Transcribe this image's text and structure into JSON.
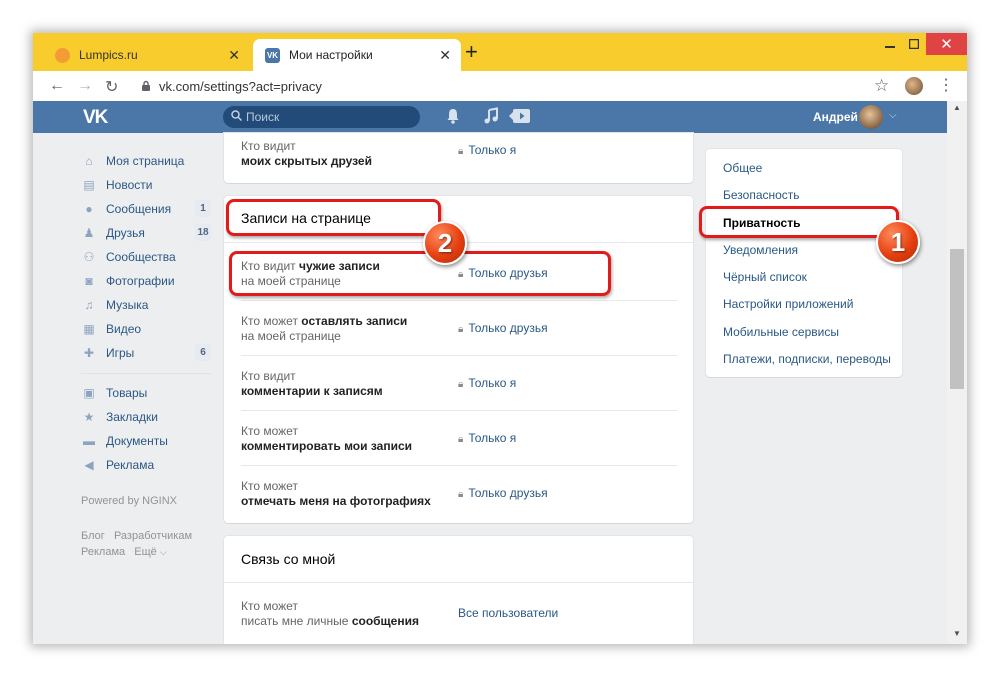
{
  "browser": {
    "tabs": [
      {
        "label": "Lumpics.ru",
        "favicon": "lumpics-icon",
        "active": false
      },
      {
        "label": "Мои настройки",
        "favicon": "vk-icon",
        "active": true
      }
    ],
    "new_tab": "+",
    "url": "vk.com/settings?act=privacy"
  },
  "header": {
    "logo": "VK",
    "search_placeholder": "Поиск",
    "user_name": "Андрей"
  },
  "sidebar": {
    "items": [
      {
        "label": "Моя страница",
        "icon": "home-icon"
      },
      {
        "label": "Новости",
        "icon": "news-icon"
      },
      {
        "label": "Сообщения",
        "icon": "messages-icon",
        "count": "1"
      },
      {
        "label": "Друзья",
        "icon": "friends-icon",
        "count": "18"
      },
      {
        "label": "Сообщества",
        "icon": "communities-icon"
      },
      {
        "label": "Фотографии",
        "icon": "photos-icon"
      },
      {
        "label": "Музыка",
        "icon": "music-icon"
      },
      {
        "label": "Видео",
        "icon": "video-icon"
      },
      {
        "label": "Игры",
        "icon": "games-icon",
        "count": "6"
      },
      {
        "label": "Товары",
        "icon": "goods-icon"
      },
      {
        "label": "Закладки",
        "icon": "bookmarks-icon"
      },
      {
        "label": "Документы",
        "icon": "documents-icon"
      },
      {
        "label": "Реклама",
        "icon": "ads-icon"
      }
    ],
    "powered": "Powered by NGINX",
    "footer_links": [
      "Блог",
      "Разработчикам",
      "Реклама",
      "Ещё"
    ]
  },
  "main": {
    "top_card": {
      "question_prefix": "Кто видит",
      "question_bold": "моих скрытых друзей",
      "answer": "Только я"
    },
    "posts_card": {
      "title": "Записи на странице",
      "rows": [
        {
          "q1": "Кто видит",
          "q1_bold": "чужие записи",
          "q2": "на моей странице",
          "q2_bold": "",
          "answer": "Только друзья"
        },
        {
          "q1": "Кто может",
          "q1_bold": "оставлять записи",
          "q2": "на моей странице",
          "q2_bold": "",
          "answer": "Только друзья"
        },
        {
          "q1": "Кто видит",
          "q1_bold": "",
          "q2": "",
          "q2_bold": "комментарии к записям",
          "answer": "Только я"
        },
        {
          "q1": "Кто может",
          "q1_bold": "",
          "q2": "",
          "q2_bold": "комментировать мои записи",
          "answer": "Только я"
        },
        {
          "q1": "Кто может",
          "q1_bold": "",
          "q2": "",
          "q2_bold": "отмечать меня на фотографиях",
          "answer": "Только друзья"
        }
      ]
    },
    "contact_card": {
      "title": "Связь со мной",
      "rows": [
        {
          "q1": "Кто может",
          "q2": "писать мне личные",
          "q2_bold": "сообщения",
          "answer": "Все пользователи"
        }
      ]
    }
  },
  "settings_menu": {
    "items": [
      "Общее",
      "Безопасность",
      "Приватность",
      "Уведомления",
      "Чёрный список",
      "Настройки приложений",
      "Мобильные сервисы",
      "Платежи, подписки, переводы"
    ],
    "active_index": 2
  },
  "annotations": {
    "badge_1": "1",
    "badge_2": "2",
    "color": "#e11a1a"
  },
  "colors": {
    "vk_blue": "#4a76a8",
    "tab_bar": "#f7cc2c",
    "link": "#2a5885"
  }
}
